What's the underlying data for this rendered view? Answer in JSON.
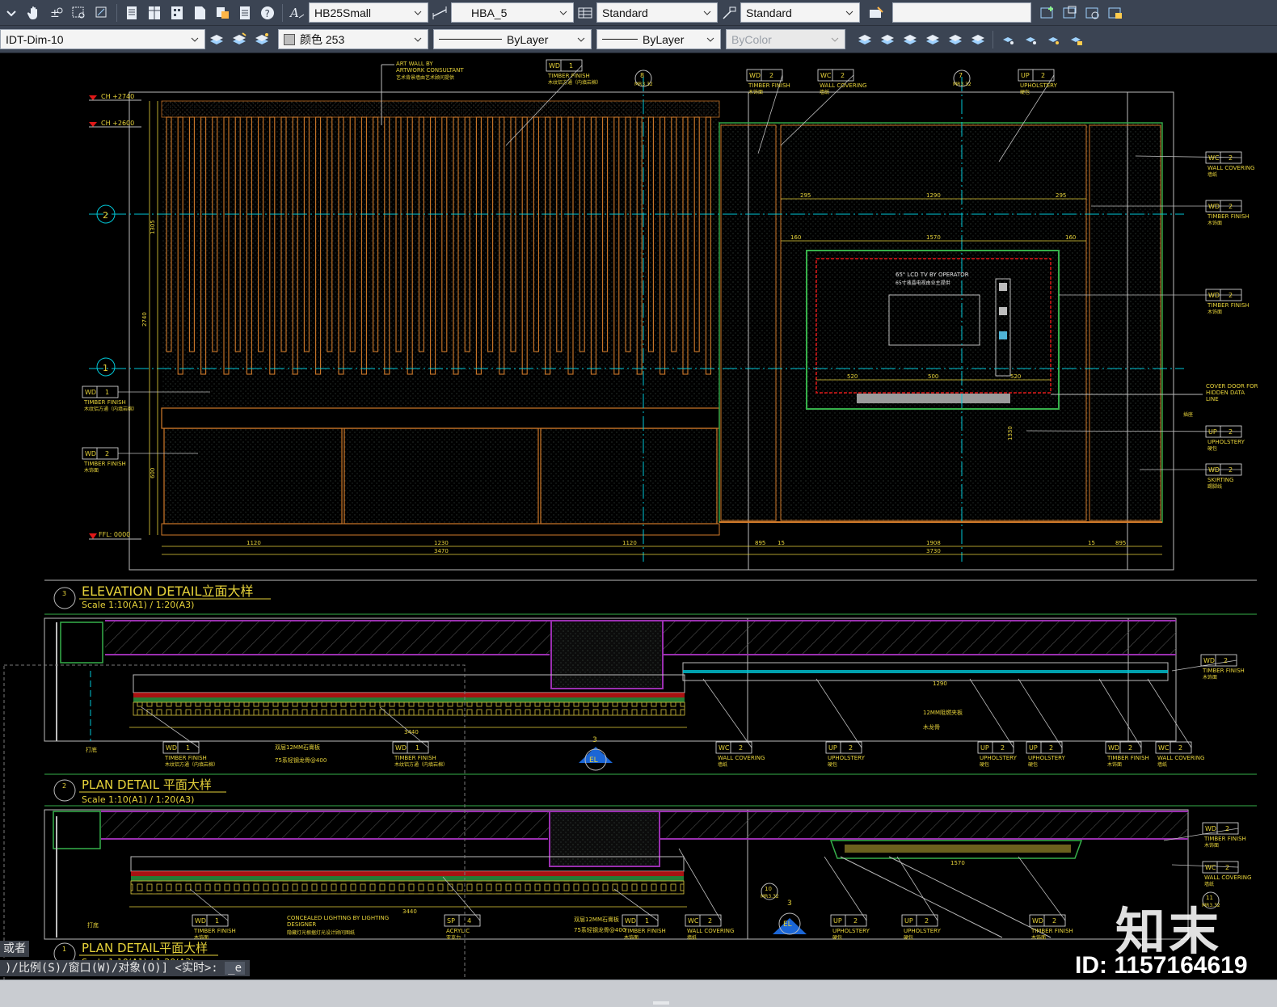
{
  "toolbar1": {
    "text_style": "HB25Small",
    "dim_style": "HBA_5",
    "table_style": "Standard",
    "mleader_style": "Standard",
    "search_value": ""
  },
  "toolbar2": {
    "layer": "IDT-Dim-10",
    "color": "颜色 253",
    "linetype": "ByLayer",
    "lineweight": "ByLayer",
    "plotstyle": "ByColor"
  },
  "drawing": {
    "levels": {
      "ch1": "CH +2740",
      "ch2": "CH +2600",
      "ffl": "FFL: 0000"
    },
    "tags": [
      {
        "code": "WD",
        "num": "1",
        "desc": "TIMBER FINISH",
        "cn": "木纹铝方通（内填岩棉）"
      },
      {
        "code": "WD",
        "num": "2",
        "desc": "TIMBER FINISH",
        "cn": "木饰面"
      },
      {
        "code": "WC",
        "num": "2",
        "desc": "WALL COVERING",
        "cn": "墙纸"
      },
      {
        "code": "UP",
        "num": "2",
        "desc": "UPHOLSTERY",
        "cn": "硬包"
      },
      {
        "code": "WD",
        "num": "1",
        "desc": "TIMBER FINISH",
        "cn": "木饰面"
      },
      {
        "code": "WD",
        "num": "2",
        "desc": "SKIRTING",
        "cn": "踢脚线"
      },
      {
        "code": "SP",
        "num": "4",
        "desc": "ACRYLIC",
        "cn": "亚克力"
      }
    ],
    "art_wall": {
      "line1": "ART WALL BY",
      "line2": "ARTWORK CONSULTANT",
      "cn": "艺术背景墙由艺术顾问提供"
    },
    "tv": {
      "line1": "65\" LCD TV BY OPERATOR",
      "cn": "65寸液晶电视由业主提供"
    },
    "cover_door": {
      "line1": "COVER DOOR FOR",
      "line2": "HIDDEN DATA",
      "line3": "LINE"
    },
    "dims": {
      "d1120a": "1120",
      "d1230": "1230",
      "d1120b": "1120",
      "d3470": "3470",
      "d895a": "895",
      "d15a": "15",
      "d1908": "1908",
      "d15b": "15",
      "d895b": "895",
      "d3730": "3730",
      "d295a": "295",
      "d1290": "1290",
      "d295b": "295",
      "d160a": "160",
      "d1570": "1570",
      "d160b": "160",
      "d520a": "520",
      "d500": "500",
      "d520b": "520",
      "d2740": "2740",
      "d3440a": "3440",
      "d3440b": "3440",
      "d600": "600",
      "d1330": "1330",
      "d1305": "1305"
    },
    "grid": {
      "g1": "1",
      "g2": "2",
      "g3": "3",
      "sec3": "3",
      "el": "EL"
    },
    "callouts": {
      "c8": "8",
      "c8s": "MR3.32",
      "c7": "7",
      "c7s": "MR3.32",
      "c10": "10",
      "c10s": "MR3.32",
      "c11": "11",
      "c11s": "MR3.32"
    },
    "notes": {
      "dagu": "打底",
      "acc1": "双层12MM石膏板",
      "acc2": "75系轻钢龙骨@400",
      "acc3": "12MM阻燃夹板",
      "acc4": "木龙骨",
      "lighting1": "CONCEALED LIGHTING BY LIGHTING",
      "lighting2": "DESIGNER",
      "lighting_cn": "隐藏灯光根据灯光设计顾问图纸",
      "side": "插座"
    },
    "titles": [
      {
        "no": "3",
        "title": "ELEVATION   DETAIL立面大样",
        "scale": "Scale 1:10(A1) / 1:20(A3)"
      },
      {
        "no": "2",
        "title": "PLAN  DETAIL 平面大样",
        "scale": "Scale 1:10(A1) / 1:20(A3)"
      },
      {
        "no": "1",
        "title": "PLAN DETAIL平面大样",
        "scale": "Scale 1:10(A1) / 1:20(A3)"
      }
    ]
  },
  "command": {
    "prefix": "或者",
    "line": ")/比例(S)/窗口(W)/对象(O)] <实时>: ",
    "tail": "_e"
  },
  "watermark": {
    "brand": "知末",
    "id": "ID: 1157164619"
  },
  "colors": {
    "toolbar_bg": "#3b4453",
    "timber": "#d07a2a",
    "cyan": "#00c8d8",
    "yellow": "#e6d23a",
    "magenta": "#9a2fb0",
    "red": "#e01818",
    "green": "#36b04a"
  }
}
